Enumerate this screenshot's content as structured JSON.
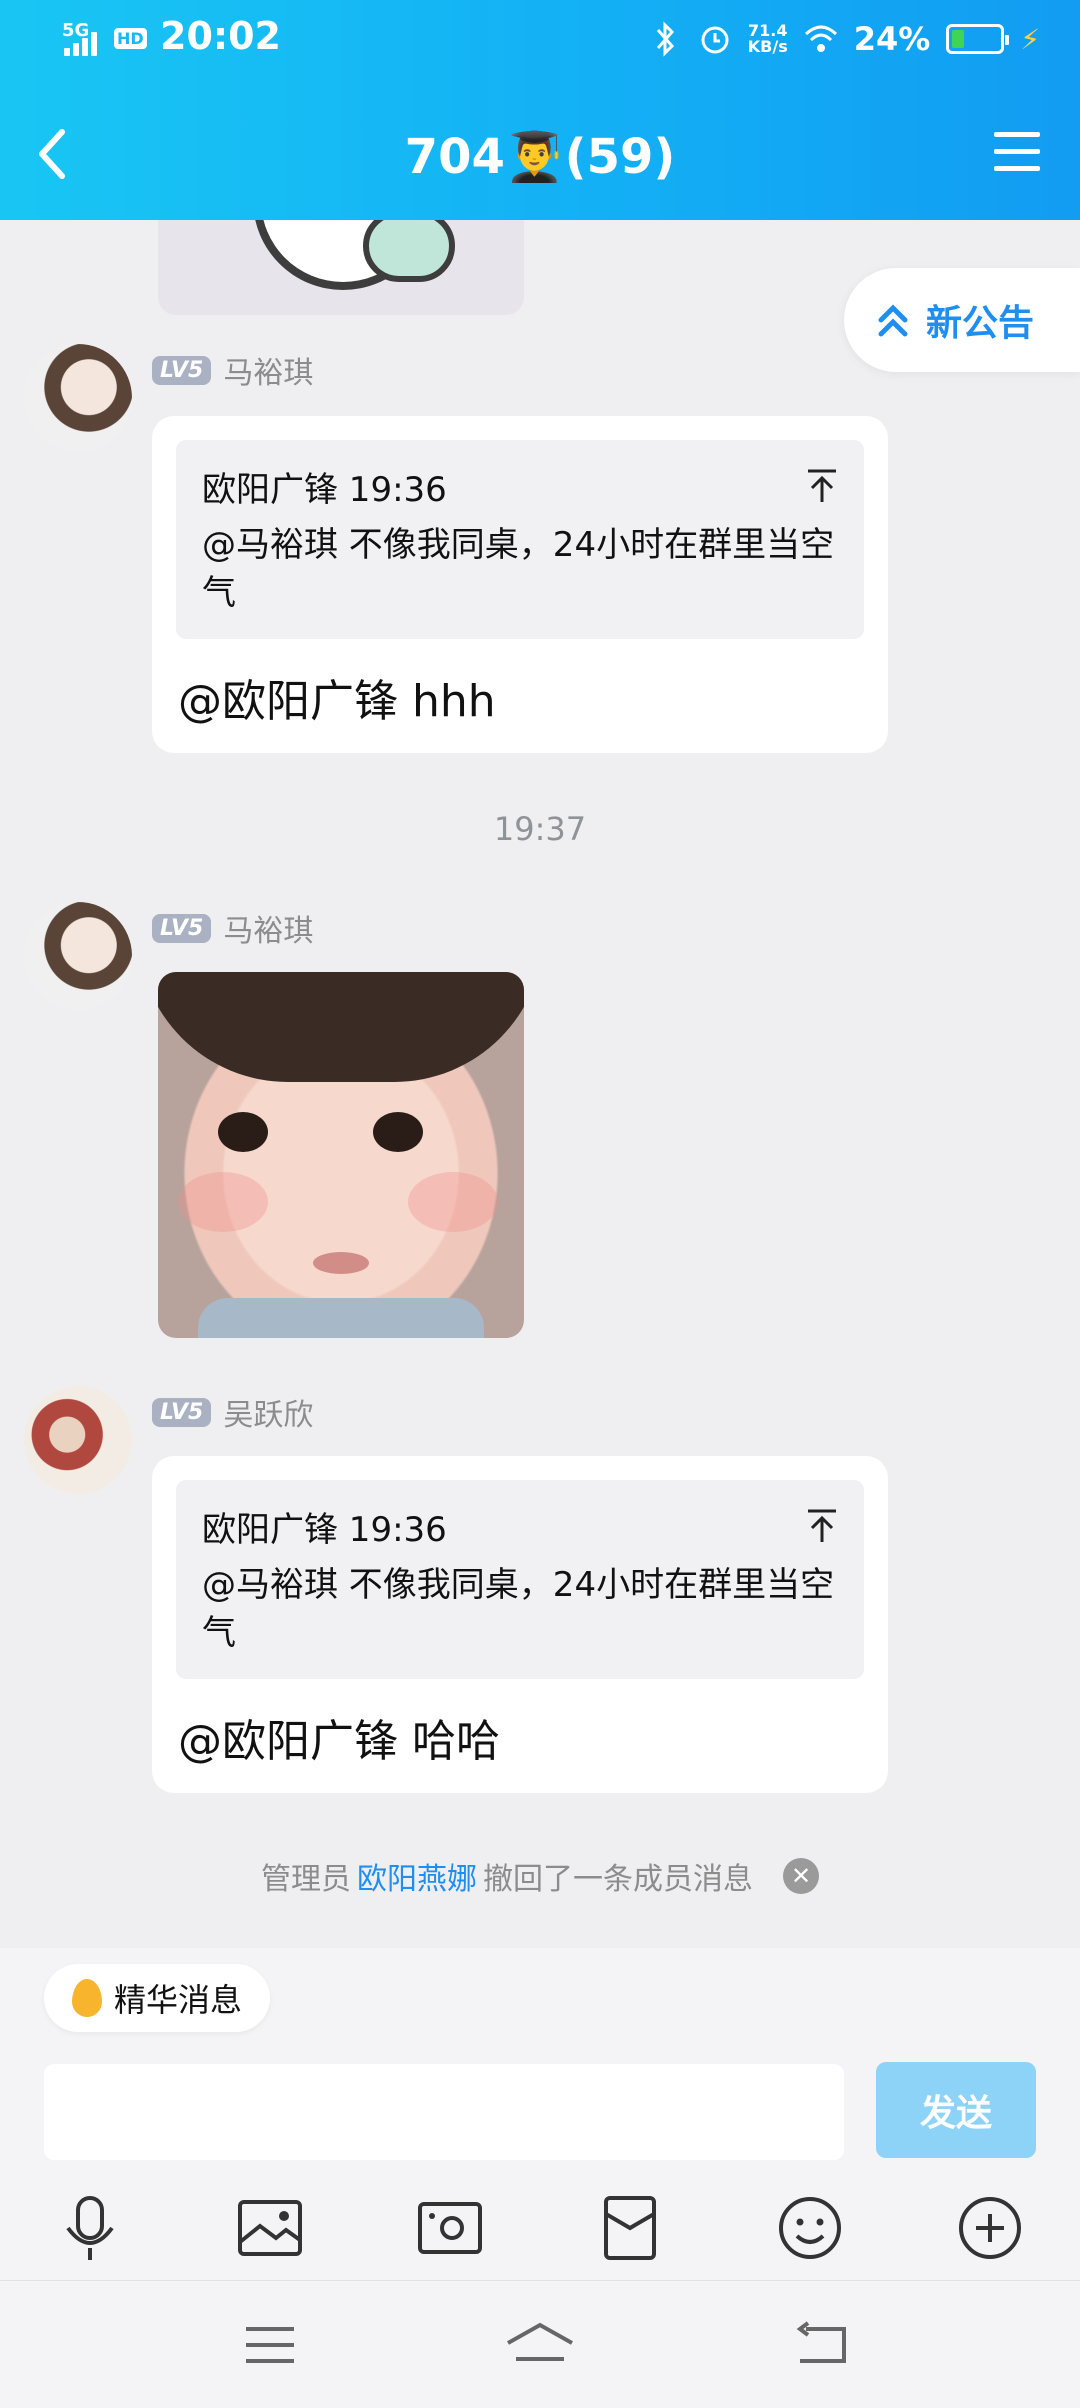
{
  "status_bar": {
    "network": "5G",
    "hd": "HD",
    "time": "20:02",
    "speed_value": "71.4",
    "speed_unit": "KB/s",
    "battery": "24%",
    "battery_level": 0.24,
    "icons": [
      "bluetooth-icon",
      "alarm-icon",
      "wifi-icon",
      "battery-icon",
      "charging-icon"
    ]
  },
  "header": {
    "title": "704👨‍🎓(59)",
    "back_icon": "chevron-left-icon",
    "menu_icon": "hamburger-icon"
  },
  "notice": {
    "label": "新公告"
  },
  "messages": [
    {
      "level": "LV5",
      "sender": "马裕琪",
      "quote": {
        "author_time": "欧阳广锋 19:36",
        "text": "@马裕琪 不像我同桌，24小时在群里当空气"
      },
      "reply": "@欧阳广锋 hhh"
    },
    {
      "timestamp": "19:37"
    },
    {
      "level": "LV5",
      "sender": "马裕琪",
      "image": "baby-face-sticker"
    },
    {
      "level": "LV5",
      "sender": "吴跃欣",
      "quote": {
        "author_time": "欧阳广锋 19:36",
        "text": "@马裕琪 不像我同桌，24小时在群里当空气"
      },
      "reply": "@欧阳广锋 哈哈"
    }
  ],
  "recall_notice": {
    "prefix": "管理员",
    "admin": "欧阳燕娜",
    "suffix": "撤回了一条成员消息"
  },
  "bottom": {
    "essence_label": "精华消息",
    "input_placeholder": "",
    "send_label": "发送",
    "tools": [
      "microphone-icon",
      "image-icon",
      "camera-icon",
      "red-packet-icon",
      "emoji-icon",
      "plus-icon"
    ]
  },
  "colors": {
    "header": "#13b0f5",
    "accent": "#1f8ef1",
    "send": "#8dd2f7"
  }
}
